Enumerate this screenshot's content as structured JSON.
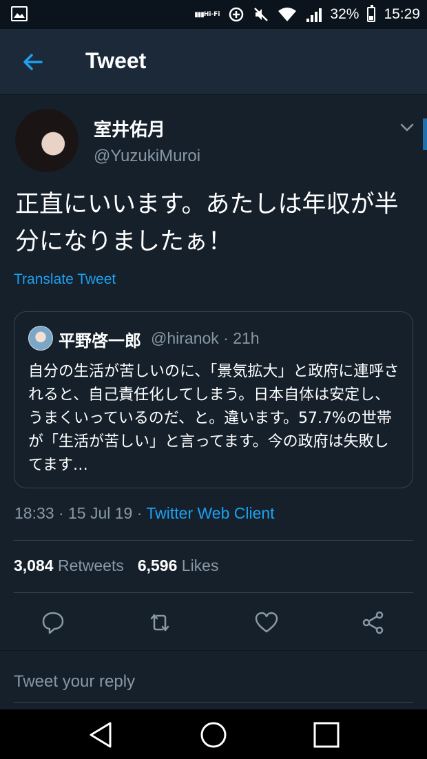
{
  "status_bar": {
    "battery": "32%",
    "time": "15:29",
    "battery_level": 0.32,
    "icons": [
      "image-icon",
      "hifi-icon",
      "data-saver-icon",
      "mute-icon",
      "wifi-icon",
      "signal-icon",
      "battery-icon"
    ]
  },
  "header": {
    "title": "Tweet",
    "back_icon": "arrow-left-icon"
  },
  "tweet": {
    "author_name": "室井佑月",
    "author_handle": "@YuzukiMuroi",
    "text": "正直にいいます。あたしは年収が半分になりましたぁ！",
    "translate": "Translate Tweet",
    "timestamp": "18:33 · 15 Jul 19 · ",
    "client": "Twitter Web Client"
  },
  "quote": {
    "name": "平野啓一郎",
    "meta": "@hiranok · 21h",
    "text": "自分の生活が苦しいのに、「景気拡大」と政府に連呼されると、自己責任化してしまう。日本自体は安定し、うまくいっているのだ、と。違います。57.7%の世帯が「生活が苦しい」と言ってます。今の政府は失敗してます…"
  },
  "stats": {
    "retweets_count": "3,084",
    "retweets_label": "Retweets",
    "likes_count": "6,596",
    "likes_label": "Likes"
  },
  "actions": [
    "reply-icon",
    "retweet-icon",
    "like-icon",
    "share-icon"
  ],
  "reply": {
    "placeholder": "Tweet your reply"
  },
  "colors": {
    "background": "#15202b",
    "header": "#1c2938",
    "accent": "#1da1f2",
    "muted": "#8899a6",
    "border": "#38444d"
  }
}
